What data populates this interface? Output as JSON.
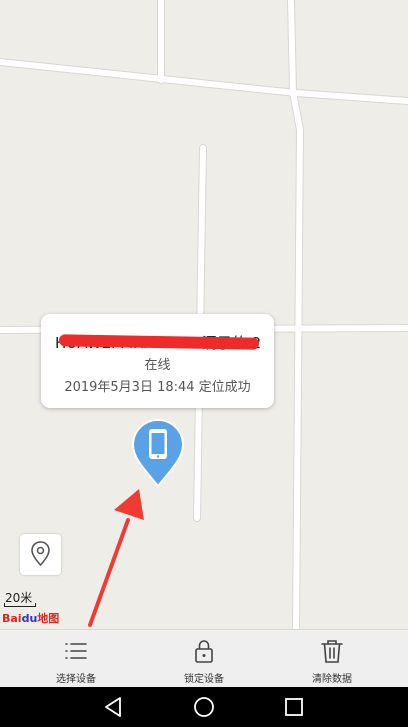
{
  "popup": {
    "device_name": "HUAWEI MHA-AL00 洞子的 20",
    "status": "在线",
    "located_time": "2019年5月3日 18:44 定位成功"
  },
  "map": {
    "scale_label": "20米",
    "logo_text_bai": "Bai",
    "logo_text_du": "du",
    "logo_text_map": "地图"
  },
  "toolbar": {
    "items": [
      {
        "label": "选择设备",
        "icon": "list-icon"
      },
      {
        "label": "锁定设备",
        "icon": "lock-icon"
      },
      {
        "label": "清除数据",
        "icon": "trash-icon"
      }
    ]
  },
  "navbar": {
    "icons": [
      "back-icon",
      "home-icon",
      "recents-icon"
    ]
  },
  "colors": {
    "map_bg": "#efede8",
    "road": "#ffffff",
    "pin": "#5aa2e6",
    "annotation_arrow": "#ef3b34",
    "toolbar_bg": "#efefef"
  }
}
